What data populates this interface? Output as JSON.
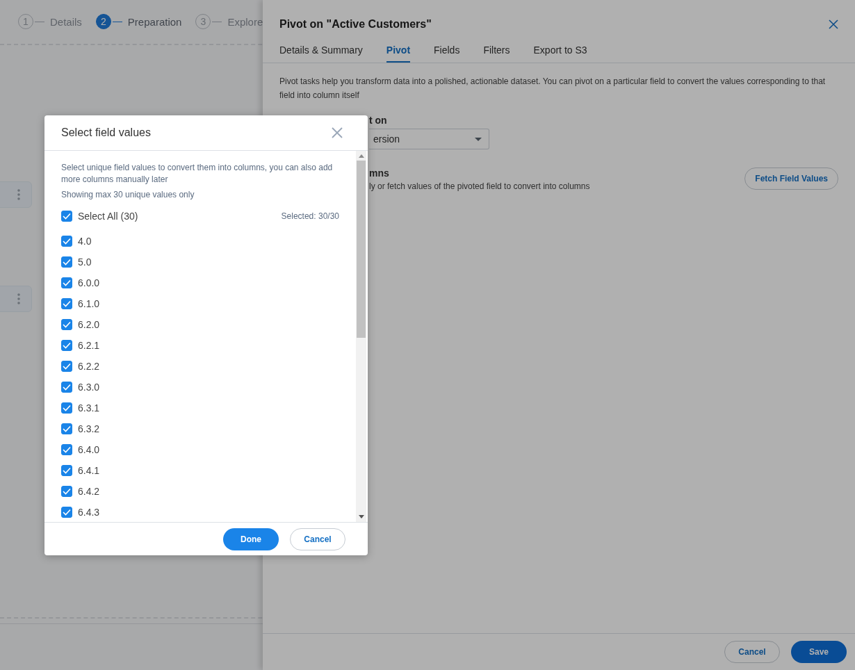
{
  "stepper": {
    "steps": [
      {
        "number": "1",
        "label": "Details",
        "selected": false
      },
      {
        "number": "2",
        "label": "Preparation",
        "selected": true
      },
      {
        "number": "3",
        "label": "Explore",
        "selected": false
      }
    ]
  },
  "drawer": {
    "title": "Pivot on \"Active Customers\"",
    "tabs": [
      {
        "label": "Details & Summary",
        "selected": false
      },
      {
        "label": "Pivot",
        "selected": true
      },
      {
        "label": "Fields",
        "selected": false
      },
      {
        "label": "Filters",
        "selected": false
      },
      {
        "label": "Export to S3",
        "selected": false
      }
    ],
    "description": "Pivot tasks help you transform data into a polished, actionable dataset. You can pivot on a particular field to convert the values corresponding to that field into column itself",
    "pivot_field": {
      "label": "t on",
      "value": "ersion"
    },
    "columns_section": {
      "heading": "mns",
      "hint": "ly or fetch values of the pivoted field to convert into columns",
      "fetch_button": "Fetch Field Values"
    },
    "buttons": {
      "cancel": "Cancel",
      "save": "Save"
    }
  },
  "modal": {
    "title": "Select field values",
    "intro": "Select unique field values to convert them into columns, you can also add more columns manually later",
    "note": "Showing max 30 unique values only",
    "select_all": {
      "label": "Select All (30)",
      "checked": true
    },
    "selected_count": "Selected: 30/30",
    "values": [
      {
        "label": "4.0",
        "checked": true
      },
      {
        "label": "5.0",
        "checked": true
      },
      {
        "label": "6.0.0",
        "checked": true
      },
      {
        "label": "6.1.0",
        "checked": true
      },
      {
        "label": "6.2.0",
        "checked": true
      },
      {
        "label": "6.2.1",
        "checked": true
      },
      {
        "label": "6.2.2",
        "checked": true
      },
      {
        "label": "6.3.0",
        "checked": true
      },
      {
        "label": "6.3.1",
        "checked": true
      },
      {
        "label": "6.3.2",
        "checked": true
      },
      {
        "label": "6.4.0",
        "checked": true
      },
      {
        "label": "6.4.1",
        "checked": true
      },
      {
        "label": "6.4.2",
        "checked": true
      },
      {
        "label": "6.4.3",
        "checked": true
      }
    ],
    "buttons": {
      "done": "Done",
      "cancel": "Cancel"
    }
  }
}
